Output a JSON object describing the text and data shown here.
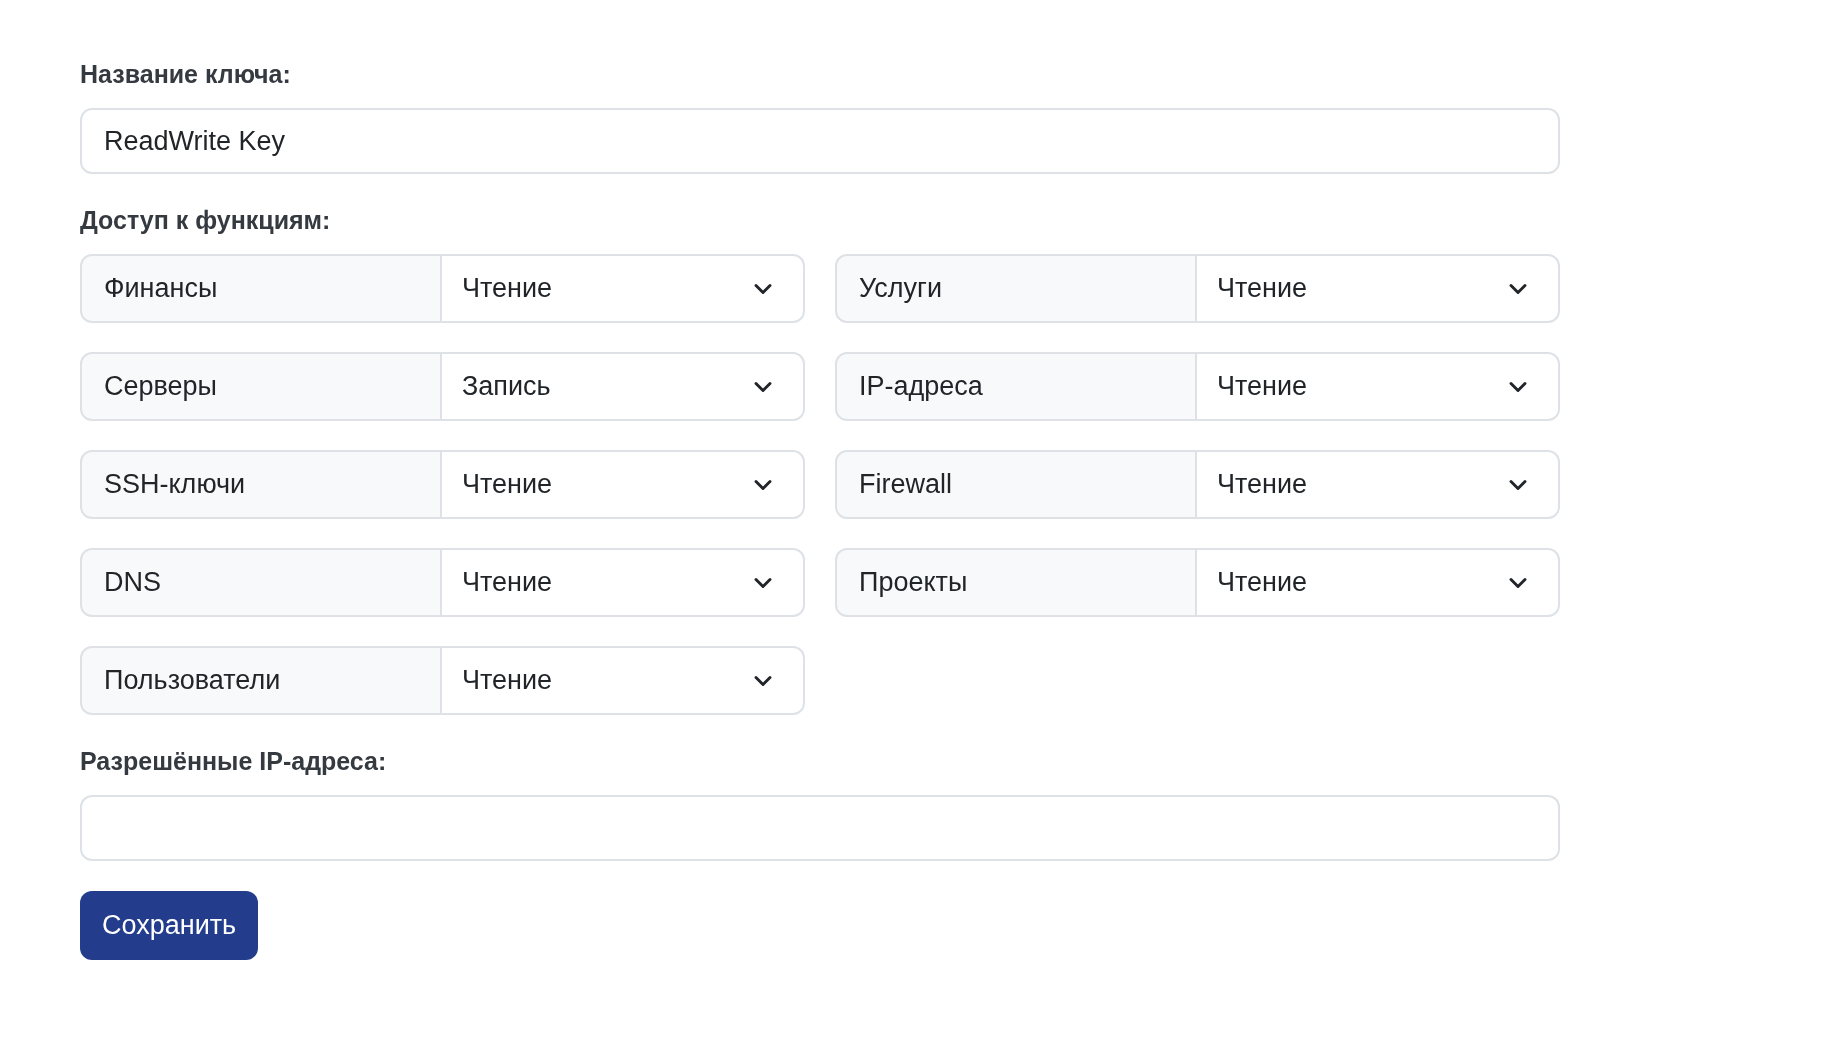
{
  "key_name": {
    "label": "Название ключа:",
    "value": "ReadWrite Key"
  },
  "permissions": {
    "label": "Доступ к функциям:",
    "items": [
      {
        "name": "Финансы",
        "value": "Чтение"
      },
      {
        "name": "Услуги",
        "value": "Чтение"
      },
      {
        "name": "Серверы",
        "value": "Запись"
      },
      {
        "name": "IP-адреса",
        "value": "Чтение"
      },
      {
        "name": "SSH-ключи",
        "value": "Чтение"
      },
      {
        "name": "Firewall",
        "value": "Чтение"
      },
      {
        "name": "DNS",
        "value": "Чтение"
      },
      {
        "name": "Проекты",
        "value": "Чтение"
      },
      {
        "name": "Пользователи",
        "value": "Чтение"
      }
    ]
  },
  "allowed_ips": {
    "label": "Разрешённые IP-адреса:"
  },
  "save_button": "Сохранить"
}
